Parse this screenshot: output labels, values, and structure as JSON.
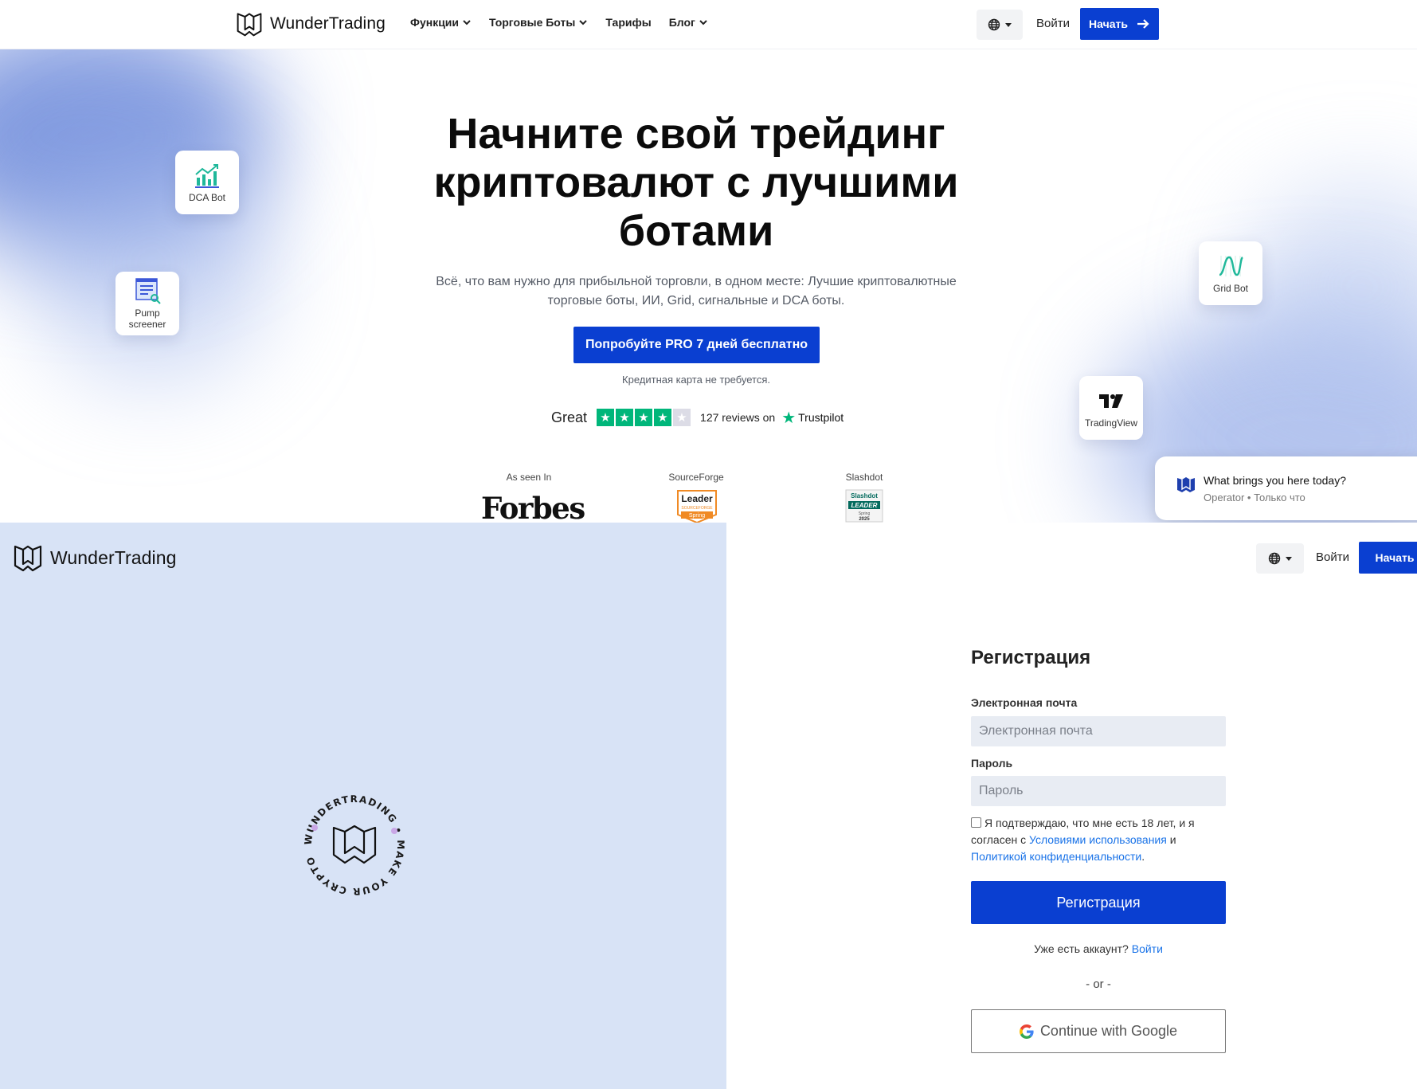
{
  "brand": {
    "name": "WunderTrading"
  },
  "landing": {
    "nav": {
      "items": [
        {
          "label": "Функции",
          "has_dropdown": true
        },
        {
          "label": "Торговые Боты",
          "has_dropdown": true
        },
        {
          "label": "Тарифы",
          "has_dropdown": false
        },
        {
          "label": "Блог",
          "has_dropdown": true
        }
      ],
      "login": "Войти",
      "start": "Начать"
    },
    "hero": {
      "title": "Начните свой трейдинг криптовалют с лучшими ботами",
      "subtitle": "Всё, что вам нужно для прибыльной торговли, в одном месте: Лучшие криптовалютные торговые боты, ИИ, Grid, сигнальные и DCA боты.",
      "cta": "Попробуйте PRO 7 дней бесплатно",
      "note": "Кредитная карта не требуется."
    },
    "trustpilot": {
      "rating_word": "Great",
      "stars": 4,
      "stars_max": 5,
      "reviews": "127 reviews on",
      "brand": "Trustpilot"
    },
    "seen_in": [
      {
        "label": "As seen In",
        "logo": "Forbes"
      },
      {
        "label": "SourceForge",
        "badge_lines": [
          "Leader",
          "SOURCEFORGE",
          "Spring"
        ]
      },
      {
        "label": "Slashdot",
        "badge_lines": [
          "Slashdot",
          "LEADER",
          "Spring",
          "2025"
        ]
      }
    ],
    "feature_cards": {
      "dca": "DCA Bot",
      "pump": "Pump screener",
      "grid": "Grid Bot",
      "tradingview": "TradingView"
    },
    "chat": {
      "question": "What brings you here today?",
      "meta": "Operator • Только что"
    }
  },
  "register": {
    "seal_text": "WUNDERTRADING • MAKE YOUR CRYPTO WORK •",
    "header": {
      "login": "Войти",
      "start": "Начать"
    },
    "title": "Регистрация",
    "email_label": "Электронная почта",
    "email_placeholder": "Электронная почта",
    "password_label": "Пароль",
    "password_placeholder": "Пароль",
    "agree_prefix": "Я подтверждаю, что мне есть 18 лет, и я согласен с",
    "terms_link": "Условиями использования",
    "agree_and": "и",
    "privacy_link": "Политикой конфиденциальности",
    "agree_end": ".",
    "submit": "Регистрация",
    "have_account": "Уже есть аккаунт?",
    "login_link": "Войти",
    "or": "- or -",
    "google": "Continue with Google"
  },
  "colors": {
    "primary": "#0a3fd1",
    "link": "#1a73e8",
    "left_panel": "#d8e3f6",
    "trustpilot_green": "#00b67a"
  }
}
